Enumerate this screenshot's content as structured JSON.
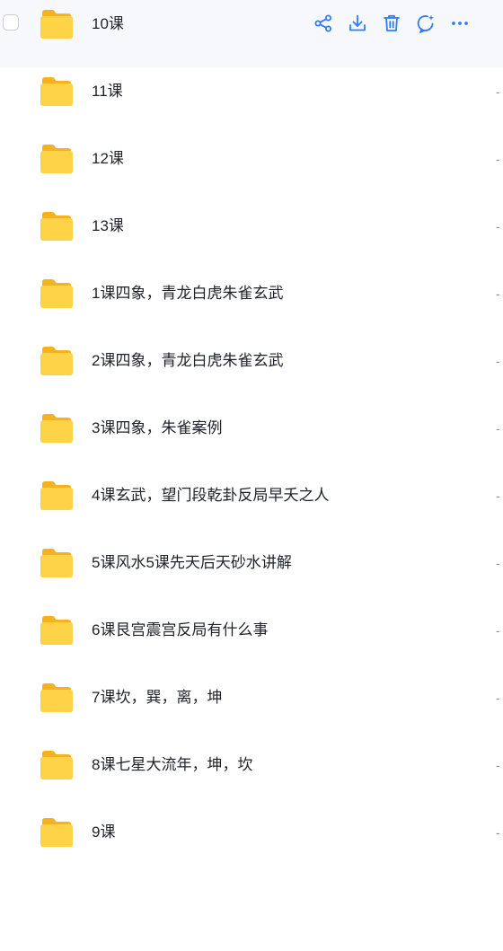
{
  "colors": {
    "accent": "#2f7cf6",
    "folder_back": "#f6b21a",
    "folder_front": "#ffd348",
    "hover_row": "#f7f8fc"
  },
  "row_actions": [
    {
      "name": "share-icon"
    },
    {
      "name": "download-icon"
    },
    {
      "name": "trash-icon"
    },
    {
      "name": "ai-chat-icon"
    },
    {
      "name": "more-icon"
    }
  ],
  "files": [
    {
      "name": "10课",
      "trailing": ""
    },
    {
      "name": "11课",
      "trailing": "-"
    },
    {
      "name": "12课",
      "trailing": "-"
    },
    {
      "name": "13课",
      "trailing": "-"
    },
    {
      "name": "1课四象，青龙白虎朱雀玄武",
      "trailing": "-"
    },
    {
      "name": "2课四象，青龙白虎朱雀玄武",
      "trailing": "-"
    },
    {
      "name": "3课四象，朱雀案例",
      "trailing": "-"
    },
    {
      "name": "4课玄武，望门段乾卦反局早夭之人",
      "trailing": "-"
    },
    {
      "name": "5课风水5课先天后天砂水讲解",
      "trailing": "-"
    },
    {
      "name": "6课艮宫震宫反局有什么事",
      "trailing": "-"
    },
    {
      "name": "7课坎，巽，离，坤",
      "trailing": "-"
    },
    {
      "name": "8课七星大流年，坤，坎",
      "trailing": "-"
    },
    {
      "name": "9课",
      "trailing": "-"
    }
  ]
}
